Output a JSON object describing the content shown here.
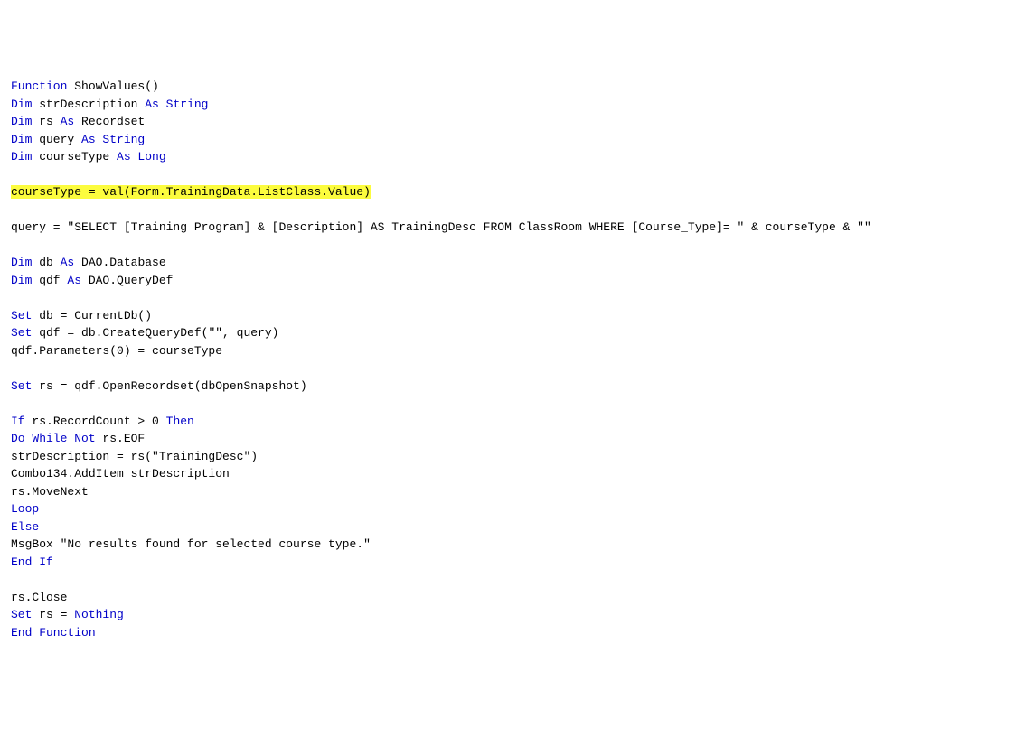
{
  "code": {
    "l1_kw1": "Function",
    "l1_txt1": " ShowValues()",
    "l2_kw1": "Dim",
    "l2_txt1": " strDescription ",
    "l2_kw2": "As String",
    "l3_kw1": "Dim",
    "l3_txt1": " rs ",
    "l3_kw2": "As",
    "l3_txt2": " Recordset",
    "l4_kw1": "Dim",
    "l4_txt1": " query ",
    "l4_kw2": "As String",
    "l5_kw1": "Dim",
    "l5_txt1": " courseType ",
    "l5_kw2": "As Long",
    "l6_hl": "courseType = val(Form.TrainingData.ListClass.Value)",
    "l7_txt1": "query = \"SELECT [Training Program] & [Description] AS TrainingDesc FROM ClassRoom WHERE [Course_Type]= \" & courseType & \"\"",
    "l8_kw1": "Dim",
    "l8_txt1": " db ",
    "l8_kw2": "As",
    "l8_txt2": " DAO.Database",
    "l9_kw1": "Dim",
    "l9_txt1": " qdf ",
    "l9_kw2": "As",
    "l9_txt2": " DAO.QueryDef",
    "l10_kw1": "Set",
    "l10_txt1": " db = CurrentDb()",
    "l11_kw1": "Set",
    "l11_txt1": " qdf = db.CreateQueryDef(\"\", query)",
    "l12_txt1": "qdf.Parameters(0) = courseType",
    "l13_kw1": "Set",
    "l13_txt1": " rs = qdf.OpenRecordset(dbOpenSnapshot)",
    "l14_kw1": "If",
    "l14_txt1": " rs.RecordCount > 0 ",
    "l14_kw2": "Then",
    "l15_kw1": "Do While Not",
    "l15_txt1": " rs.EOF",
    "l16_txt1": "strDescription = rs(\"TrainingDesc\")",
    "l17_txt1": "Combo134.AddItem strDescription",
    "l18_txt1": "rs.MoveNext",
    "l19_kw1": "Loop",
    "l20_kw1": "Else",
    "l21_txt1": "MsgBox \"No results found for selected course type.\"",
    "l22_kw1": "End If",
    "l23_txt1": "rs.Close",
    "l24_kw1": "Set",
    "l24_txt1": " rs = ",
    "l24_kw2": "Nothing",
    "l25_kw1": "End Function"
  }
}
